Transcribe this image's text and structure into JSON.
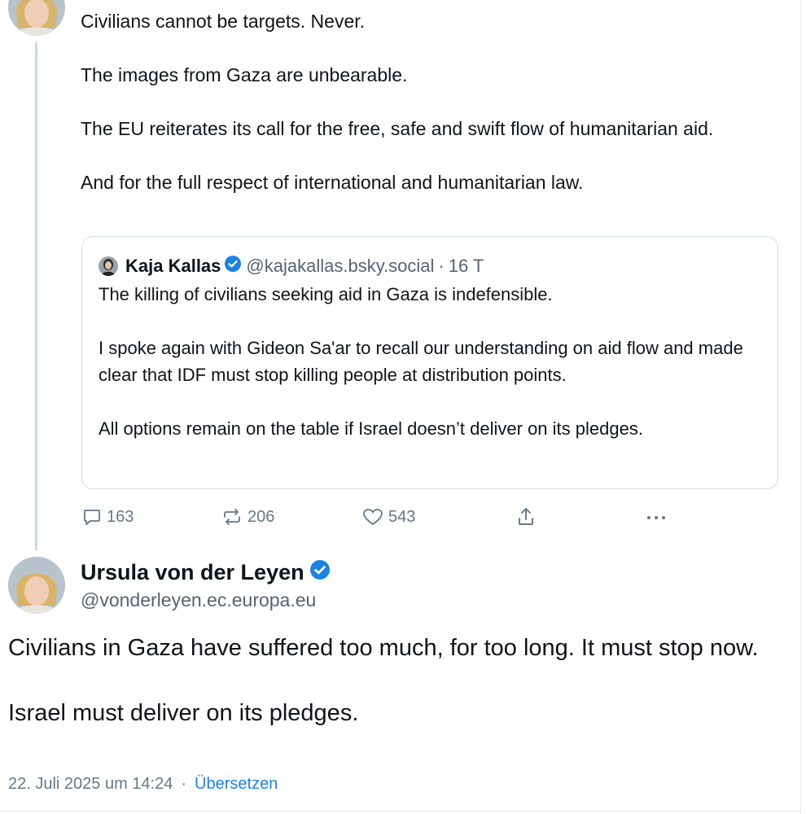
{
  "post1": {
    "paragraphs": [
      "Civilians cannot be targets. Never.",
      "The images from Gaza are unbearable.",
      "The EU reiterates its call for the free, safe and swift flow of humanitarian aid.",
      "And for the full respect of international and humanitarian law."
    ]
  },
  "quote": {
    "name": "Kaja Kallas",
    "handle": "@kajakallas.bsky.social",
    "separator": "·",
    "time": "16 T",
    "paragraphs": [
      "The killing of civilians seeking aid in Gaza is indefensible.",
      "I spoke again with Gideon Sa'ar to recall our understanding on aid flow and made clear that IDF must stop killing people at distribution points.",
      "All options remain on the table if Israel doesn’t deliver on its pledges."
    ]
  },
  "actions": {
    "replies": "163",
    "reposts": "206",
    "likes": "543"
  },
  "post2": {
    "author_name": "Ursula von der Leyen",
    "author_handle": "@vonderleyen.ec.europa.eu",
    "paragraphs": [
      "Civilians in Gaza have suffered too much, for too long. It must stop now.",
      "Israel must deliver on its pledges."
    ],
    "timestamp": "22. Juli 2025 um 14:24",
    "separator": "·",
    "translate_label": "Übersetzen"
  },
  "icons": {
    "reply": "speech-bubble-icon",
    "repost": "repost-arrows-icon",
    "like": "heart-icon",
    "share": "share-upload-icon",
    "more": "ellipsis-icon",
    "verified": "verified-badge-icon"
  },
  "colors": {
    "verified_blue": "#1d83e0",
    "muted": "#667788",
    "thread_line": "#c9d7ea"
  }
}
